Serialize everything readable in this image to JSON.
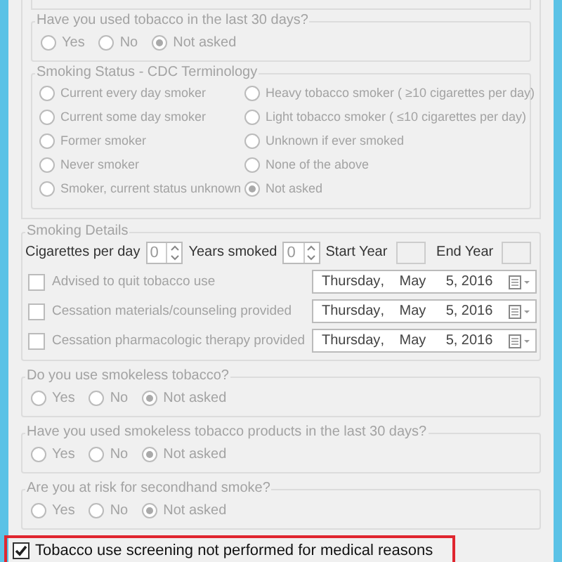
{
  "tobacco_30_days": {
    "title": "Have you used tobacco in the last 30 days?",
    "disabled": true,
    "options": [
      {
        "label": "Yes",
        "selected": false
      },
      {
        "label": "No",
        "selected": false
      },
      {
        "label": "Not asked",
        "selected": true
      }
    ]
  },
  "smoking_status": {
    "title": "Smoking Status - CDC Terminology",
    "disabled": true,
    "options": [
      {
        "label": "Current every day smoker",
        "selected": false
      },
      {
        "label": "Heavy tobacco smoker ( ≥10 cigarettes per day)",
        "selected": false
      },
      {
        "label": "Current some day smoker",
        "selected": false
      },
      {
        "label": "Light tobacco smoker ( ≤10 cigarettes per day)",
        "selected": false
      },
      {
        "label": "Former smoker",
        "selected": false
      },
      {
        "label": "Unknown if ever smoked",
        "selected": false
      },
      {
        "label": "Never smoker",
        "selected": false
      },
      {
        "label": "None of the above",
        "selected": false
      },
      {
        "label": "Smoker, current status unknown",
        "selected": false
      },
      {
        "label": "Not asked",
        "selected": true
      }
    ]
  },
  "smoking_details": {
    "title": "Smoking Details",
    "fields": [
      {
        "kind": "spinner",
        "label": "Cigarettes per day",
        "value": "0"
      },
      {
        "kind": "spinner",
        "label": "Years smoked",
        "value": "0"
      },
      {
        "kind": "year",
        "label": "Start Year"
      },
      {
        "kind": "year",
        "label": "End Year"
      }
    ],
    "actions": [
      {
        "label": "Advised to quit tobacco use",
        "checked": false,
        "disabled": true,
        "date": {
          "weekday": "Thursday",
          "separator": ",",
          "month": "May",
          "day": "5, 2016"
        }
      },
      {
        "label": "Cessation materials/counseling provided",
        "checked": false,
        "disabled": true,
        "date": {
          "weekday": "Thursday",
          "separator": ",",
          "month": "May",
          "day": "5, 2016"
        }
      },
      {
        "label": "Cessation pharmacologic therapy provided",
        "checked": false,
        "disabled": true,
        "date": {
          "weekday": "Thursday",
          "separator": ",",
          "month": "May",
          "day": "5, 2016"
        }
      }
    ]
  },
  "questions": [
    {
      "title": "Do you use smokeless tobacco?",
      "disabled": true,
      "options": [
        {
          "label": "Yes",
          "selected": false
        },
        {
          "label": "No",
          "selected": false
        },
        {
          "label": "Not asked",
          "selected": true
        }
      ]
    },
    {
      "title": "Have you used smokeless tobacco products in the last 30 days?",
      "disabled": true,
      "options": [
        {
          "label": "Yes",
          "selected": false
        },
        {
          "label": "No",
          "selected": false
        },
        {
          "label": "Not asked",
          "selected": true
        }
      ]
    },
    {
      "title": "Are you at risk for secondhand smoke?",
      "disabled": true,
      "options": [
        {
          "label": "Yes",
          "selected": false
        },
        {
          "label": "No",
          "selected": false
        },
        {
          "label": "Not asked",
          "selected": true
        }
      ]
    }
  ],
  "medical_exclusion": {
    "label": "Tobacco use screening not performed for medical reasons",
    "checked": true,
    "highlighted": true
  }
}
